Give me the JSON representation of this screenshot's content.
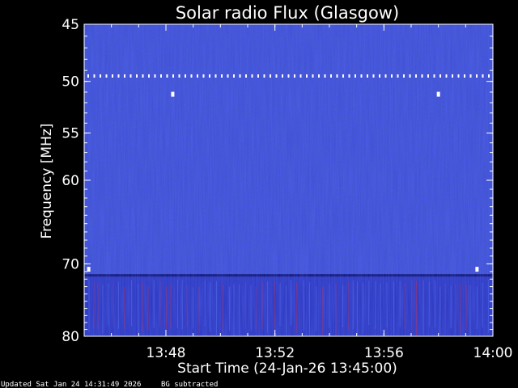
{
  "colors": {
    "background": "#000000",
    "spectrogram_base": "#2a2ed8",
    "accent_red": "#d0203a",
    "text": "#ffffff"
  },
  "chart_data": {
    "type": "heatmap",
    "title": "Solar radio Flux (Glasgow)",
    "xlabel": "Start Time (24-Jan-26 13:45:00)",
    "ylabel": "Frequency [MHz]",
    "x_range": [
      "13:45:00",
      "14:00:00"
    ],
    "x_ticks": [
      "13:48",
      "13:52",
      "13:56",
      "14:00"
    ],
    "y_range": [
      45,
      80
    ],
    "y_scale": "log",
    "y_ticks": [
      45,
      50,
      55,
      60,
      70,
      80
    ],
    "features": [
      {
        "kind": "dotted-line",
        "frequency_mhz": 49.5
      },
      {
        "kind": "bright-spots",
        "frequency_mhz": 51.2,
        "times": [
          "13:48:15",
          "13:58:00"
        ]
      },
      {
        "kind": "bright-spots",
        "frequency_mhz": 70.7,
        "times": [
          "13:45:10",
          "13:59:25"
        ]
      },
      {
        "kind": "interference-band",
        "frequency_mhz": [
          71.5,
          80
        ]
      }
    ]
  },
  "footer": {
    "updated": "Updated Sat Jan 24 14:31:49 2026",
    "note": "BG subtracted"
  }
}
